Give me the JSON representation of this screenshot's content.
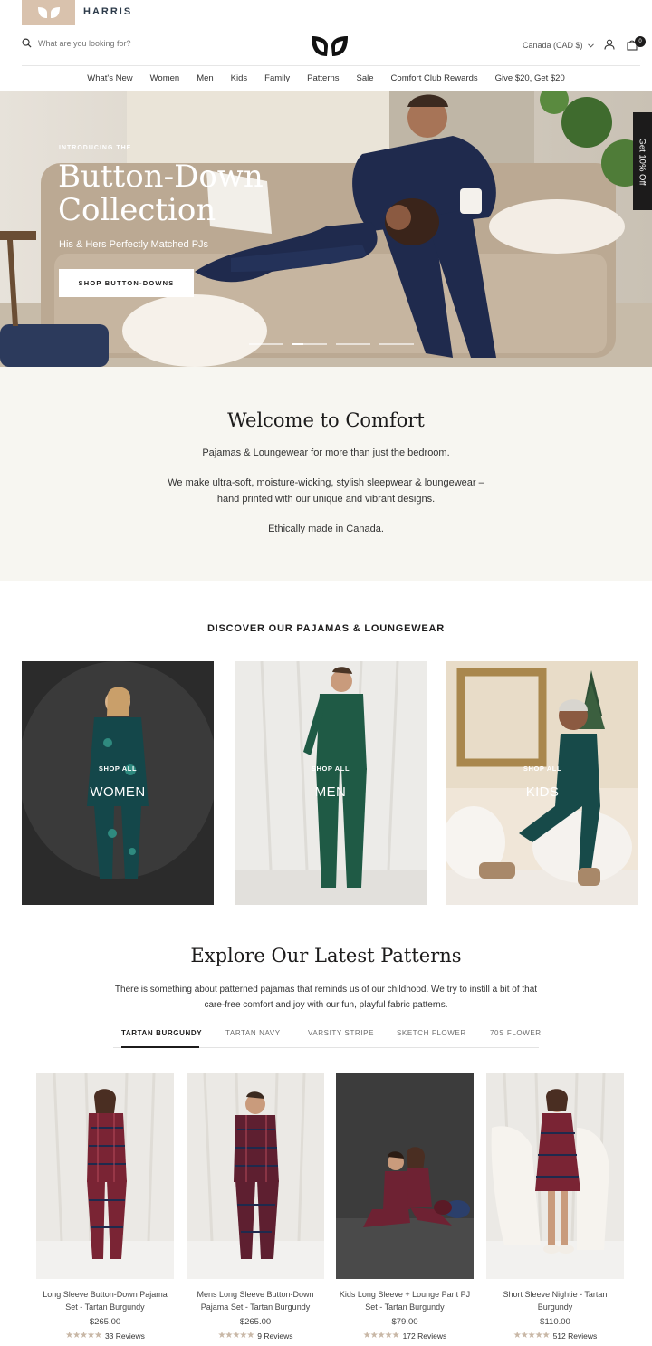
{
  "brand": {
    "name": "HARRIS"
  },
  "header": {
    "search_placeholder": "What are you looking for?",
    "currency": "Canada (CAD $)",
    "cart_count": "0"
  },
  "nav": [
    "What's New",
    "Women",
    "Men",
    "Kids",
    "Family",
    "Patterns",
    "Sale",
    "Comfort Club Rewards",
    "Give $20, Get $20"
  ],
  "hero": {
    "eyebrow": "INTRODUCING THE",
    "title_line1": "Button-Down",
    "title_line2": "Collection",
    "subtitle": "His & Hers Perfectly Matched PJs",
    "button": "SHOP BUTTON-DOWNS",
    "side_tab": "Get 10% Off",
    "slides": 4,
    "active_slide": 2
  },
  "welcome": {
    "title": "Welcome to Comfort",
    "p1": "Pajamas & Loungewear for more than just the bedroom.",
    "p2_line1": "We make ultra-soft, moisture-wicking, stylish sleepwear & loungewear –",
    "p2_line2": "hand printed with our unique and vibrant designs.",
    "p3": "Ethically made in Canada."
  },
  "discover": {
    "title": "DISCOVER OUR PAJAMAS & LOUNGEWEAR",
    "categories": [
      {
        "shop": "SHOP ALL",
        "name": "WOMEN"
      },
      {
        "shop": "SHOP ALL",
        "name": "MEN"
      },
      {
        "shop": "SHOP ALL",
        "name": "KIDS"
      }
    ]
  },
  "patterns": {
    "title": "Explore Our Latest Patterns",
    "desc_line1": "There is something about patterned pajamas that reminds us of our childhood. We try to instill a bit of that",
    "desc_line2": "care-free comfort and joy with our fun, playful fabric patterns.",
    "tabs": [
      "TARTAN BURGUNDY",
      "TARTAN NAVY",
      "VARSITY STRIPE",
      "SKETCH FLOWER",
      "70S FLOWER"
    ],
    "products": [
      {
        "title_line1": "Long Sleeve Button-Down Pajama",
        "title_line2": "Set - Tartan Burgundy",
        "price": "$265.00",
        "stars": "★★★★★",
        "reviews": "33 Reviews"
      },
      {
        "title_line1": "Mens Long Sleeve Button-Down",
        "title_line2": "Pajama Set - Tartan Burgundy",
        "price": "$265.00",
        "stars": "★★★★★",
        "reviews": "9 Reviews"
      },
      {
        "title_line1": "Kids Long Sleeve + Lounge Pant PJ",
        "title_line2": "Set - Tartan Burgundy",
        "price": "$79.00",
        "stars": "★★★★★",
        "reviews": "172 Reviews"
      },
      {
        "title_line1": "Short Sleeve Nightie - Tartan",
        "title_line2": "Burgundy",
        "price": "$110.00",
        "stars": "★★★★★",
        "reviews": "512 Reviews"
      }
    ]
  },
  "colors": {
    "accent": "#d9c2ad",
    "navy": "#1f2a4d",
    "burgundy": "#7a2434",
    "star": "#c8b7a6"
  }
}
